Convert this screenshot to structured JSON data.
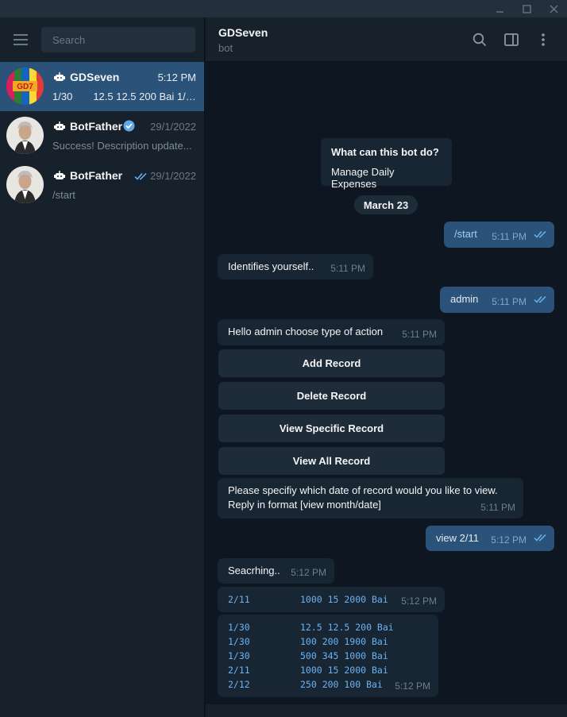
{
  "sidebar": {
    "search_placeholder": "Search",
    "chats": [
      {
        "name": "GDSeven",
        "time": "5:12 PM",
        "preview_left": "1/30",
        "preview_right": "12.5 12.5 200 Bai 1/3...",
        "active": true
      },
      {
        "name": "BotFather",
        "time": "29/1/2022",
        "preview": "Success! Description update...",
        "verified": true
      },
      {
        "name": "BotFather",
        "time": "29/1/2022",
        "preview": "/start",
        "read": true
      }
    ]
  },
  "header": {
    "title": "GDSeven",
    "subtitle": "bot"
  },
  "bot_info": {
    "title": "What can this bot do?",
    "text": "Manage Daily Expenses"
  },
  "date_separator": "March 23",
  "messages": {
    "m1": {
      "text": "/start",
      "time": "5:11 PM"
    },
    "m2": {
      "text": "Identifies yourself..",
      "time": "5:11 PM"
    },
    "m3": {
      "text": "admin",
      "time": "5:11 PM"
    },
    "m4": {
      "text": "Hello admin choose type of action",
      "time": "5:11 PM"
    },
    "m5": {
      "line1": "Please specifiy which date of record would you like to view.",
      "line2": "Reply in format [view month/date]",
      "time": "5:11 PM"
    },
    "m6": {
      "text": "view 2/11",
      "time": "5:12 PM"
    },
    "m7": {
      "text": "Seacrhing..",
      "time": "5:12 PM"
    },
    "m8": {
      "date": "2/11",
      "values": "1000 15 2000 Bai",
      "time": "5:12 PM"
    },
    "m9": {
      "rows": [
        {
          "date": "1/30",
          "values": "12.5 12.5 200 Bai"
        },
        {
          "date": "1/30",
          "values": "100 200 1900 Bai"
        },
        {
          "date": "1/30",
          "values": "500 345 1000 Bai"
        },
        {
          "date": "2/11",
          "values": "1000 15 2000 Bai"
        },
        {
          "date": "2/12",
          "values": "250 200 100 Bai"
        }
      ],
      "time": "5:12 PM"
    }
  },
  "keyboard": {
    "add": "Add Record",
    "delete": "Delete Record",
    "view_specific": "View Specific Record",
    "view_all": "View All Record"
  },
  "colors": {
    "accent": "#2b5278",
    "check": "#6ab3f3",
    "background": "#0e1621",
    "panel": "#17212b"
  }
}
